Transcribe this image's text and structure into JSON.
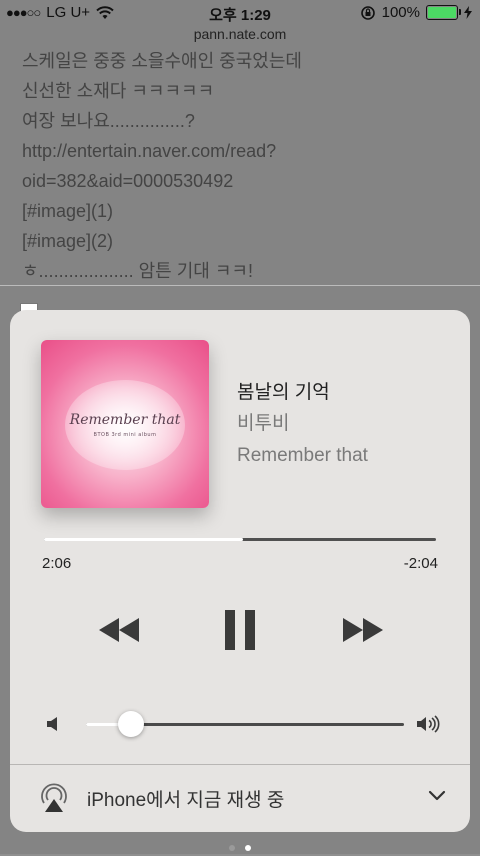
{
  "status_bar": {
    "carrier": "LG U+",
    "time": "오후 1:29",
    "battery": "100%",
    "signal_icon": "signal-dots-icon",
    "wifi_icon": "wifi-icon",
    "rotation_lock_icon": "rotation-lock-icon",
    "charging_icon": "bolt-icon"
  },
  "browser": {
    "url": "pann.nate.com"
  },
  "page": {
    "lines": [
      "스케일은 중중 소을수애인 중국었는데",
      "신선한 소재다 ㅋㅋㅋㅋㅋ",
      "여장 보나요...............?",
      "http://entertain.naver.com/read?",
      "oid=382&aid=0000530492",
      "[#image](1)",
      "[#image](2)",
      "ㅎ................... 암튼 기대 ㅋㅋ!"
    ]
  },
  "now_playing": {
    "title": "봄날의 기억",
    "artist": "비투비",
    "album": "Remember that",
    "album_art_title": "Remember that",
    "album_art_subtitle": "BTOB 3rd mini album",
    "elapsed": "2:06",
    "remaining": "-2:04",
    "progress": 0.507,
    "volume": 0.14
  },
  "controls": {
    "rewind_icon": "rewind-icon",
    "pause_icon": "pause-icon",
    "forward_icon": "fast-forward-icon",
    "volume_low_icon": "volume-low-icon",
    "volume_high_icon": "volume-high-icon"
  },
  "airplay": {
    "label": "iPhone에서 지금 재생 중",
    "icon": "airplay-icon",
    "chevron": "chevron-down-icon"
  },
  "pager": {
    "total": 2,
    "active": 1
  },
  "colors": {
    "card_bg": "#e6e4e2",
    "battery_green": "#4cd964",
    "album_pink": "#f070a0"
  }
}
